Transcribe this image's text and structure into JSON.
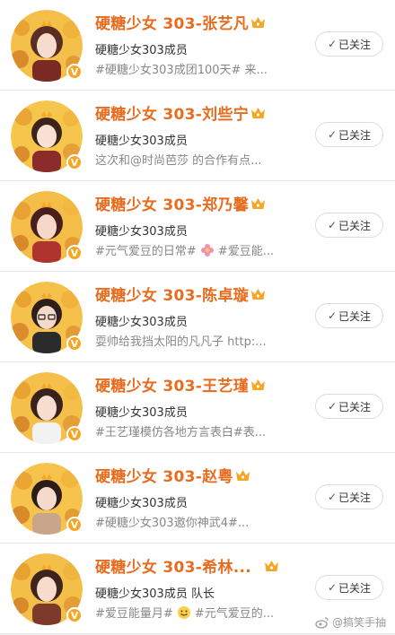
{
  "follow_label": "已关注",
  "badge_label": "V",
  "watermark": "@搞笑手抽",
  "colors": {
    "name": "#e86c1e",
    "badge": "#f6a623",
    "crown": "#f6a623"
  },
  "members": [
    {
      "name": "硬糖少女 303-张艺凡",
      "desc": "硬糖少女303成员",
      "post": "#硬糖少女303成团100天# 来...",
      "emoji": null
    },
    {
      "name": "硬糖少女 303-刘些宁",
      "desc": "硬糖少女303成员",
      "post": "这次和@时尚芭莎 的合作有点...",
      "emoji": null
    },
    {
      "name": "硬糖少女 303-郑乃馨",
      "desc": "硬糖少女303成员",
      "post": "#元气爱豆的日常#",
      "post2": "#爱豆能...",
      "emoji": "flower-emoji"
    },
    {
      "name": "硬糖少女 303-陈卓璇",
      "desc": "硬糖少女303成员",
      "post": "耍帅给我挡太阳的凡凡子 http:...",
      "emoji": null
    },
    {
      "name": "硬糖少女 303-王艺瑾",
      "desc": "硬糖少女303成员",
      "post": "#王艺瑾模仿各地方言表白#表...",
      "emoji": null
    },
    {
      "name": "硬糖少女 303-赵粤",
      "desc": "硬糖少女303成员",
      "post": "#硬糖少女303邀你神武4#...",
      "emoji": null
    },
    {
      "name": "硬糖少女 303-希林...",
      "desc": "硬糖少女303成员 队长",
      "post": "#爱豆能量月#",
      "post2": "#元气爱豆的...",
      "emoji": "smile-emoji"
    }
  ]
}
